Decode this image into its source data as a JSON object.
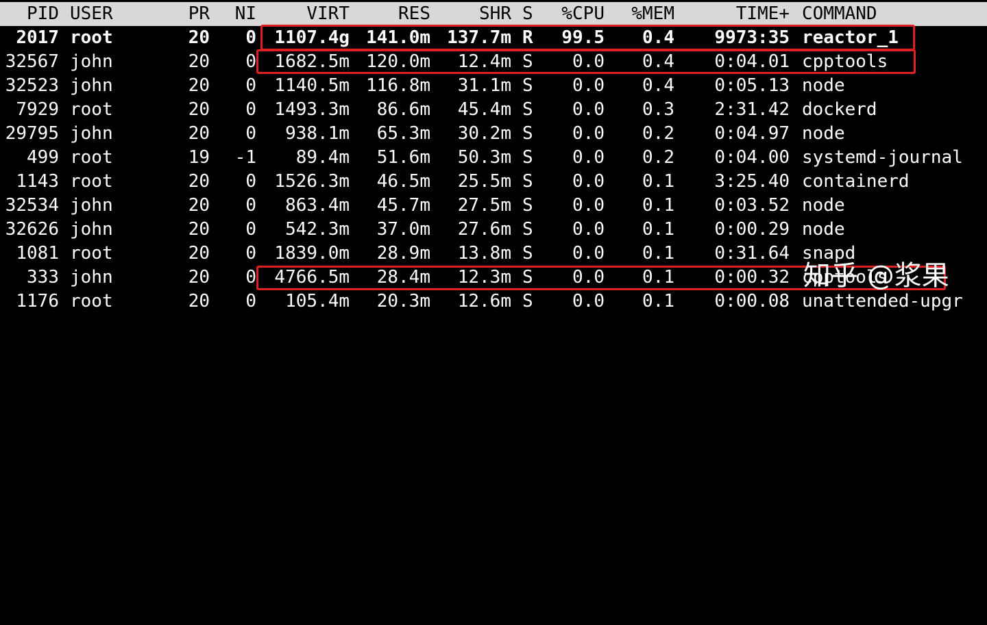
{
  "columns": [
    "PID",
    "USER",
    "PR",
    "NI",
    "VIRT",
    "RES",
    "SHR",
    "S",
    "%CPU",
    "%MEM",
    "TIME+",
    "COMMAND"
  ],
  "processes": [
    {
      "pid": "2017",
      "user": "root",
      "pr": "20",
      "ni": "0",
      "virt": "1107.4g",
      "res": "141.0m",
      "shr": "137.7m",
      "s": "R",
      "cpu": "99.5",
      "mem": "0.4",
      "time": "9973:35",
      "command": "reactor_1"
    },
    {
      "pid": "32567",
      "user": "john",
      "pr": "20",
      "ni": "0",
      "virt": "1682.5m",
      "res": "120.0m",
      "shr": "12.4m",
      "s": "S",
      "cpu": "0.0",
      "mem": "0.4",
      "time": "0:04.01",
      "command": "cpptools"
    },
    {
      "pid": "32523",
      "user": "john",
      "pr": "20",
      "ni": "0",
      "virt": "1140.5m",
      "res": "116.8m",
      "shr": "31.1m",
      "s": "S",
      "cpu": "0.0",
      "mem": "0.4",
      "time": "0:05.13",
      "command": "node"
    },
    {
      "pid": "7929",
      "user": "root",
      "pr": "20",
      "ni": "0",
      "virt": "1493.3m",
      "res": "86.6m",
      "shr": "45.4m",
      "s": "S",
      "cpu": "0.0",
      "mem": "0.3",
      "time": "2:31.42",
      "command": "dockerd"
    },
    {
      "pid": "29795",
      "user": "john",
      "pr": "20",
      "ni": "0",
      "virt": "938.1m",
      "res": "65.3m",
      "shr": "30.2m",
      "s": "S",
      "cpu": "0.0",
      "mem": "0.2",
      "time": "0:04.97",
      "command": "node"
    },
    {
      "pid": "499",
      "user": "root",
      "pr": "19",
      "ni": "-1",
      "virt": "89.4m",
      "res": "51.6m",
      "shr": "50.3m",
      "s": "S",
      "cpu": "0.0",
      "mem": "0.2",
      "time": "0:04.00",
      "command": "systemd-journal"
    },
    {
      "pid": "1143",
      "user": "root",
      "pr": "20",
      "ni": "0",
      "virt": "1526.3m",
      "res": "46.5m",
      "shr": "25.5m",
      "s": "S",
      "cpu": "0.0",
      "mem": "0.1",
      "time": "3:25.40",
      "command": "containerd"
    },
    {
      "pid": "32534",
      "user": "john",
      "pr": "20",
      "ni": "0",
      "virt": "863.4m",
      "res": "45.7m",
      "shr": "27.5m",
      "s": "S",
      "cpu": "0.0",
      "mem": "0.1",
      "time": "0:03.52",
      "command": "node"
    },
    {
      "pid": "32626",
      "user": "john",
      "pr": "20",
      "ni": "0",
      "virt": "542.3m",
      "res": "37.0m",
      "shr": "27.6m",
      "s": "S",
      "cpu": "0.0",
      "mem": "0.1",
      "time": "0:00.29",
      "command": "node"
    },
    {
      "pid": "1081",
      "user": "root",
      "pr": "20",
      "ni": "0",
      "virt": "1839.0m",
      "res": "28.9m",
      "shr": "13.8m",
      "s": "S",
      "cpu": "0.0",
      "mem": "0.1",
      "time": "0:31.64",
      "command": "snapd"
    },
    {
      "pid": "333",
      "user": "john",
      "pr": "20",
      "ni": "0",
      "virt": "4766.5m",
      "res": "28.4m",
      "shr": "12.3m",
      "s": "S",
      "cpu": "0.0",
      "mem": "0.1",
      "time": "0:00.32",
      "command": "cpptools"
    },
    {
      "pid": "1176",
      "user": "root",
      "pr": "20",
      "ni": "0",
      "virt": "105.4m",
      "res": "20.3m",
      "shr": "12.6m",
      "s": "S",
      "cpu": "0.0",
      "mem": "0.1",
      "time": "0:00.08",
      "command": "unattended-upgr"
    }
  ],
  "watermark": "知乎 @浆果",
  "colors": {
    "background": "#000000",
    "text": "#ffffff",
    "header_bg": "#d8d8d8",
    "header_text": "#000000",
    "highlight": "#e02020"
  }
}
